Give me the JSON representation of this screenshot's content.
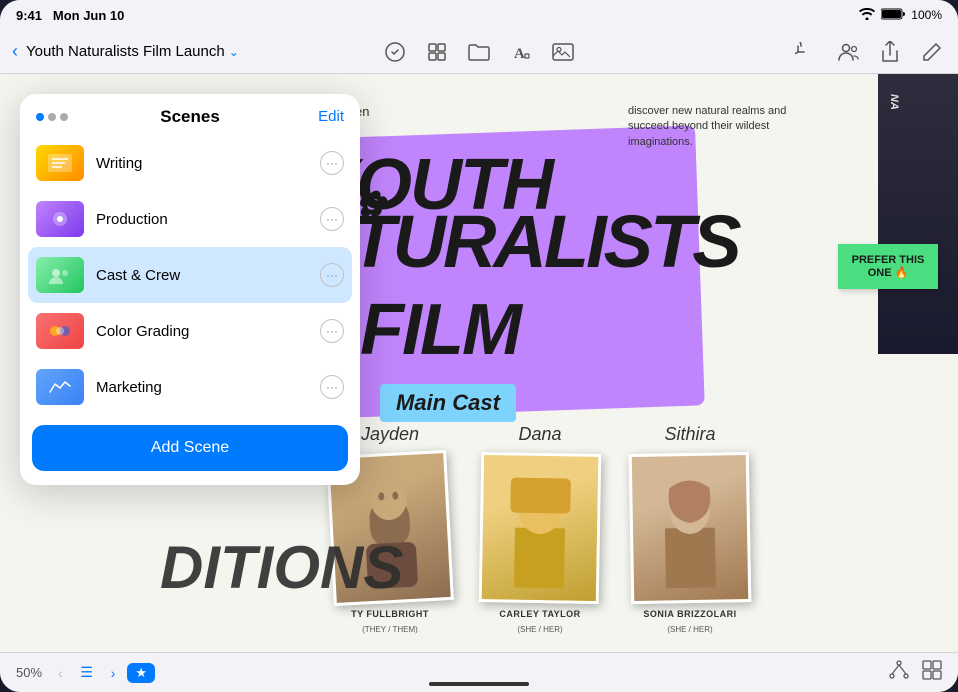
{
  "status_bar": {
    "time": "9:41",
    "date": "Mon Jun 10",
    "wifi": "WiFi",
    "battery": "100%"
  },
  "toolbar": {
    "back_label": "‹",
    "doc_title": "Youth Naturalists Film Launch",
    "dropdown_arrow": "⌄",
    "dots": "•••",
    "share_icon": "share",
    "edit_icon": "edit",
    "undo_icon": "undo",
    "people_icon": "people",
    "more_icon": "more"
  },
  "scenes_panel": {
    "title": "Scenes",
    "edit_label": "Edit",
    "items": [
      {
        "id": 1,
        "label": "Writing",
        "thumb_class": "scene-thumb-1"
      },
      {
        "id": 2,
        "label": "Production",
        "thumb_class": "scene-thumb-2"
      },
      {
        "id": 3,
        "label": "Cast & Crew",
        "thumb_class": "scene-thumb-3",
        "active": true
      },
      {
        "id": 4,
        "label": "Color Grading",
        "thumb_class": "scene-thumb-4"
      },
      {
        "id": 5,
        "label": "Marketing",
        "thumb_class": "scene-thumb-5"
      }
    ],
    "add_scene_label": "Add Scene"
  },
  "canvas": {
    "aileen_label": "Aileen Zeigen",
    "discover_text": "discover new natural realms and succeed beyond their wildest imaginations.",
    "film_title_1": "YOUTH",
    "film_title_2": "NATURALISTS",
    "film_title_3": "FILM",
    "main_cast_label": "Main Cast",
    "sticky_note": "PREFER THIS ONE 🔥",
    "cast": [
      {
        "name_script": "Jayden",
        "name": "TY FULLBRIGHT",
        "pronoun": "(THEY / THEM)"
      },
      {
        "name_script": "Dana",
        "name": "CARLEY TAYLOR",
        "pronoun": "(SHE / HER)"
      },
      {
        "name_script": "Sithira",
        "name": "SONIA BRIZZOLARI",
        "pronoun": "(SHE / HER)"
      }
    ],
    "bottom_text": "DITIONS"
  },
  "bottom_bar": {
    "zoom": "50%",
    "prev_arrow": "‹",
    "list_icon": "☰",
    "next_arrow": "›",
    "star_label": "★"
  }
}
